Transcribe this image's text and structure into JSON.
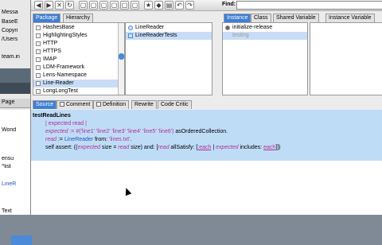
{
  "bg_window": {
    "lines": [
      "Messa",
      "BaseE",
      "Copyri",
      "/Users",
      "team.in",
      "",
      "Page",
      "",
      "Wond",
      "",
      "ensu",
      "^list",
      "",
      "LineR",
      "",
      "Text"
    ]
  },
  "toolbar": {
    "find_label": "Find:"
  },
  "package_tabs": [
    "Package",
    "Hierarchy"
  ],
  "packages": [
    "HashesBase",
    "HighlightingStyles",
    "HTTP",
    "HTTPS",
    "IMAP",
    "LDM-Framework",
    "Lens-Namespace",
    "Line-Reader",
    "LongLongTest"
  ],
  "classes": [
    "LineReader",
    "LineReaderTests"
  ],
  "class_tabs": [
    "Instance",
    "Class",
    "Shared Variable",
    "Instance Variable"
  ],
  "protocols": [
    "initialize-release",
    "testing"
  ],
  "editor_tabs": [
    "Source",
    "Comment",
    "Definition",
    "Rewrite",
    "Code Critic"
  ],
  "code": {
    "method": "testReadLines",
    "l1": "| expected read |",
    "l2a": "expected",
    "l2b": " := #('line1' 'line2' 'line3' 'line4' 'line5' 'line6') ",
    "l2c": "asOrderedCollection.",
    "l3a": "read",
    "l3b": " := ",
    "l3c": "LineReader",
    "l3d": " from: ",
    "l3e": "'lines.txt'",
    "l3f": ".",
    "l4a": "self assert: ((",
    "l4b": "expected",
    "l4c": " size = ",
    "l4d": "read",
    "l4e": " size) and: [",
    "l4f": "read",
    "l4g": " allSatisfy: [",
    "l4h": ":each",
    "l4i": " | ",
    "l4j": "expected",
    "l4k": " includes: ",
    "l4l": "each",
    "l4m": "]])"
  }
}
